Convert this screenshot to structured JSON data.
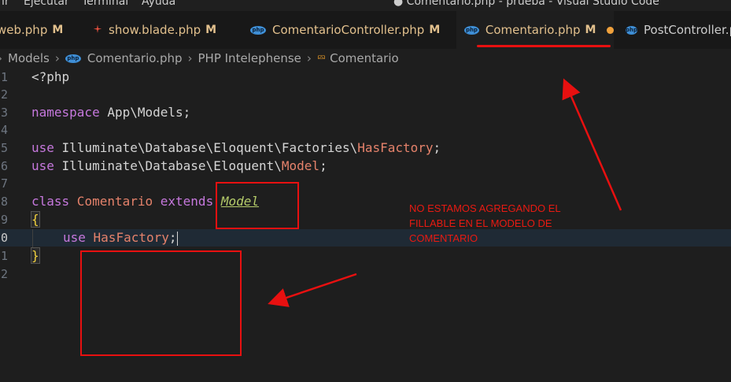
{
  "window": {
    "title": "● Comentario.php - prueba - Visual Studio Code"
  },
  "menu": {
    "items": [
      "lr",
      "Ejecutar",
      "Terminal",
      "Ayuda"
    ]
  },
  "tabs": [
    {
      "label": "web.php",
      "status": "M",
      "icon": "php-icon"
    },
    {
      "label": "show.blade.php",
      "status": "M",
      "icon": "laravel-icon"
    },
    {
      "label": "ComentarioController.php",
      "status": "M",
      "icon": "php-icon"
    },
    {
      "label": "Comentario.php",
      "status": "M",
      "icon": "php-icon",
      "active": true,
      "unsaved": true
    },
    {
      "label": "PostController.php",
      "status": "",
      "icon": "php-icon"
    }
  ],
  "breadcrumb": [
    "Models",
    "Comentario.php",
    "PHP Intelephense",
    "Comentario"
  ],
  "editor": {
    "current_line": 10,
    "line_numbers": [
      "1",
      "2",
      "3",
      "4",
      "5",
      "6",
      "7",
      "8",
      "9",
      "0",
      "1",
      "2"
    ],
    "code": {
      "l1": "<?php",
      "l3_kw": "namespace",
      "l3_rest": " App\\Models;",
      "l5_kw": "use",
      "l5_path": " Illuminate\\Database\\Eloquent\\Factories\\",
      "l5_cls": "HasFactory",
      "l5_end": ";",
      "l6_kw": "use",
      "l6_path": " Illuminate\\Database\\Eloquent\\",
      "l6_cls": "Model",
      "l6_end": ";",
      "l8_kw1": "class",
      "l8_cls": " Comentario ",
      "l8_kw2": "extends",
      "l8_model": "Model",
      "l9_brace": "{",
      "l10_kw": "use",
      "l10_cls": " HasFactory",
      "l10_end": ";",
      "l11_brace": "}"
    }
  },
  "annotation": {
    "lines": [
      "NO ESTAMOS AGREGANDO EL",
      "FILLABLE EN EL MODELO DE",
      "COMENTARIO"
    ],
    "color": "#e81010"
  },
  "colors": {
    "editor_bg": "#1e1e1e",
    "keyword": "#c678dd",
    "class_name": "#e5826b",
    "modified_tab": "#e2c08d"
  }
}
